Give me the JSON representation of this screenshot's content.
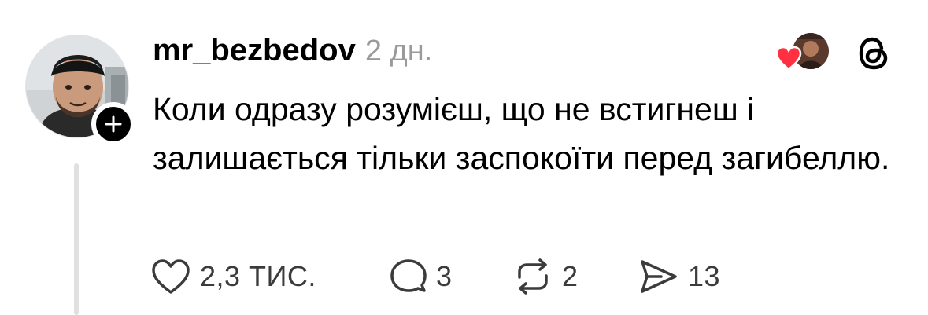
{
  "post": {
    "username": "mr_bezbedov",
    "timestamp": "2 дн.",
    "text": "Коли одразу розумієш, що не встигнеш і залишається тільки заспокоїти перед загибеллю."
  },
  "icons": {
    "avatar": "profile-photo",
    "follow": "plus-icon",
    "reaction": "heart-icon",
    "app_logo": "threads-logo-icon",
    "like": "heart-outline-icon",
    "comment": "comment-bubble-icon",
    "repost": "repost-icon",
    "share": "paper-plane-icon"
  },
  "actions": {
    "likes": "2,3 ТИС.",
    "comments": "3",
    "reposts": "2",
    "shares": "13"
  },
  "colors": {
    "heart": "#ff3040",
    "muted_text": "#9a9a9a",
    "thread_line": "#e0e0e0"
  }
}
